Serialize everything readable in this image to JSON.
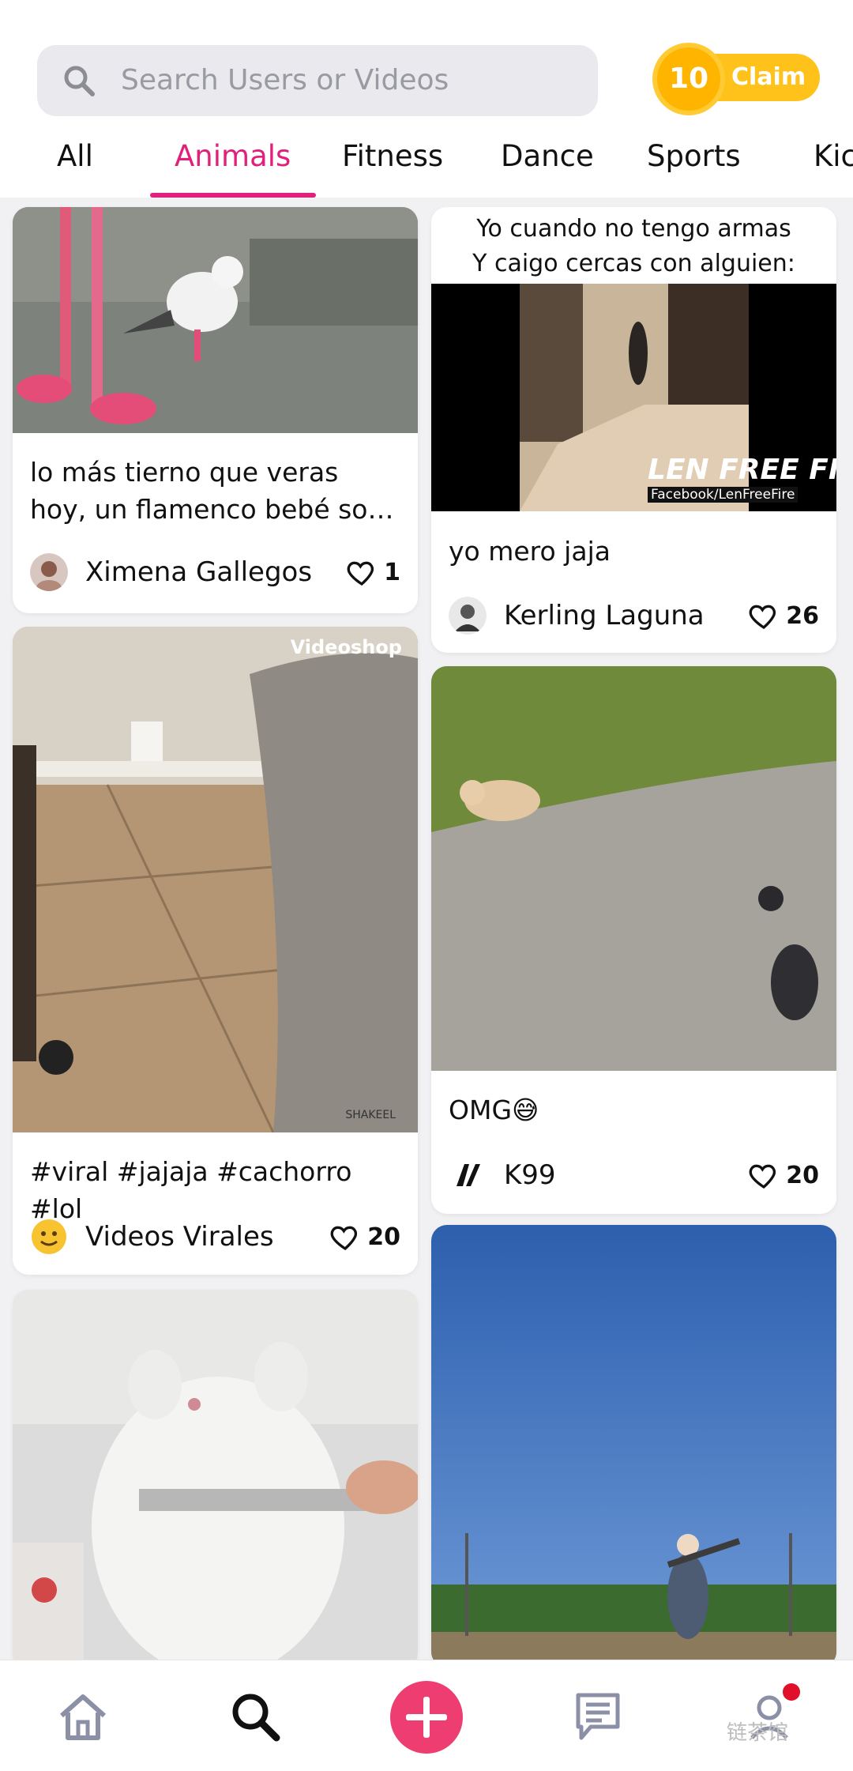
{
  "search": {
    "placeholder": "Search Users or Videos",
    "icon": "search-icon"
  },
  "claim": {
    "coins": "10",
    "label": "Claim"
  },
  "tabs": [
    {
      "label": "All",
      "active": false
    },
    {
      "label": "Animals",
      "active": true
    },
    {
      "label": "Fitness",
      "active": false
    },
    {
      "label": "Dance",
      "active": false
    },
    {
      "label": "Sports",
      "active": false
    },
    {
      "label": "Kic",
      "active": false
    }
  ],
  "cards": [
    {
      "caption": "lo más tierno que veras hoy, un flamenco bebé so…",
      "author": "Ximena Gallegos",
      "likes": "1"
    },
    {
      "overlay_line1": "Yo cuando no tengo armas",
      "overlay_line2": "Y caigo cercas con alguien:",
      "watermark": "LEN FREE FIRE",
      "watermark_sub": "Facebook/LenFreeFire",
      "caption": "yo mero jaja",
      "author": "Kerling Laguna",
      "likes": "26"
    },
    {
      "overlay": "Videoshop",
      "overlay_small": "SHAKEEL",
      "caption": "#viral #jajaja #cachorro #lol",
      "author": "Videos Virales",
      "likes": "20"
    },
    {
      "caption": "OMG😅",
      "author": "K99",
      "likes": "20"
    },
    {
      "caption": "",
      "author": "",
      "likes": ""
    },
    {
      "caption": "",
      "author": "",
      "likes": ""
    }
  ],
  "nav": {
    "home": "home-icon",
    "search": "search-icon",
    "create": "plus-icon",
    "messages": "chat-icon",
    "profile": "profile-icon"
  },
  "watermark": "链茶馆",
  "colors": {
    "accent": "#e0207a",
    "coin": "#ffc21a",
    "background": "#f1f1f3"
  }
}
